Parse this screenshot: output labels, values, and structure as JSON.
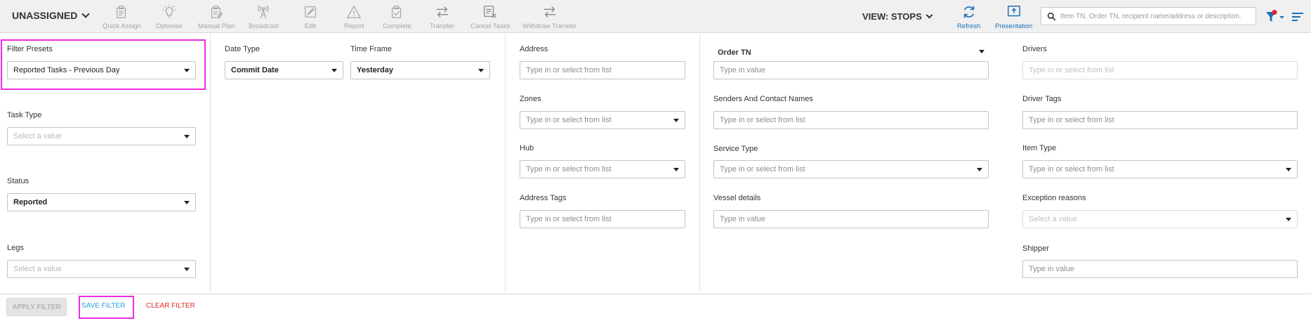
{
  "toolbar": {
    "view_dropdown": "UNASSIGNED",
    "buttons": [
      {
        "label": "Quick Assign",
        "icon": "quick-assign-icon"
      },
      {
        "label": "Optimise",
        "icon": "lightbulb-icon"
      },
      {
        "label": "Manual Plan",
        "icon": "manual-plan-icon"
      },
      {
        "label": "Broadcast",
        "icon": "broadcast-tower-icon"
      },
      {
        "label": "Edit",
        "icon": "edit-icon"
      },
      {
        "label": "Report",
        "icon": "warning-triangle-icon"
      },
      {
        "label": "Complete",
        "icon": "complete-icon"
      },
      {
        "label": "Transfer",
        "icon": "transfer-arrows-icon"
      },
      {
        "label": "Cancel Tasks",
        "icon": "cancel-tasks-icon"
      },
      {
        "label": "Withdraw Transfer",
        "icon": "withdraw-transfer-icon"
      }
    ],
    "view_stops": "VIEW: STOPS",
    "refresh_label": "Refresh",
    "presentation_label": "Presentation",
    "search_placeholder": "Item TN, Order TN, recipient name/address or description.",
    "accent_color": "#1c6fb5",
    "filter_badge_color": "#e0202b"
  },
  "filters": {
    "filter_presets": {
      "label": "Filter Presets",
      "value": "Reported Tasks - Previous Day"
    },
    "task_type": {
      "label": "Task Type",
      "placeholder": "Select a value"
    },
    "status": {
      "label": "Status",
      "value": "Reported"
    },
    "legs": {
      "label": "Legs",
      "placeholder": "Select a value"
    },
    "date_type": {
      "label": "Date Type",
      "value": "Commit Date"
    },
    "time_frame": {
      "label": "Time Frame",
      "value": "Yesterday"
    },
    "address": {
      "label": "Address",
      "placeholder": "Type in or select from list"
    },
    "zones": {
      "label": "Zones",
      "placeholder": "Type in or select from list"
    },
    "hub": {
      "label": "Hub",
      "placeholder": "Type in or select from list"
    },
    "address_tags": {
      "label": "Address Tags",
      "placeholder": "Type in or select from list"
    },
    "order_tn": {
      "label": "Order TN",
      "placeholder": "Type in value"
    },
    "senders": {
      "label": "Senders And Contact Names",
      "placeholder": "Type in or select from list"
    },
    "service_type": {
      "label": "Service Type",
      "placeholder": "Type in or select from list"
    },
    "vessel_details": {
      "label": "Vessel details",
      "placeholder": "Type in value"
    },
    "drivers": {
      "label": "Drivers",
      "placeholder": "Type in or select from list"
    },
    "driver_tags": {
      "label": "Driver Tags",
      "placeholder": "Type in or select from list"
    },
    "item_type": {
      "label": "Item Type",
      "placeholder": "Type in or select from list"
    },
    "exception_reasons": {
      "label": "Exception reasons",
      "placeholder": "Select a value"
    },
    "shipper": {
      "label": "Shipper",
      "placeholder": "Type in value"
    }
  },
  "footer": {
    "apply": "APPLY FILTER",
    "save": "SAVE FILTER",
    "clear": "CLEAR FILTER"
  },
  "highlight_color": "#ee2be2"
}
